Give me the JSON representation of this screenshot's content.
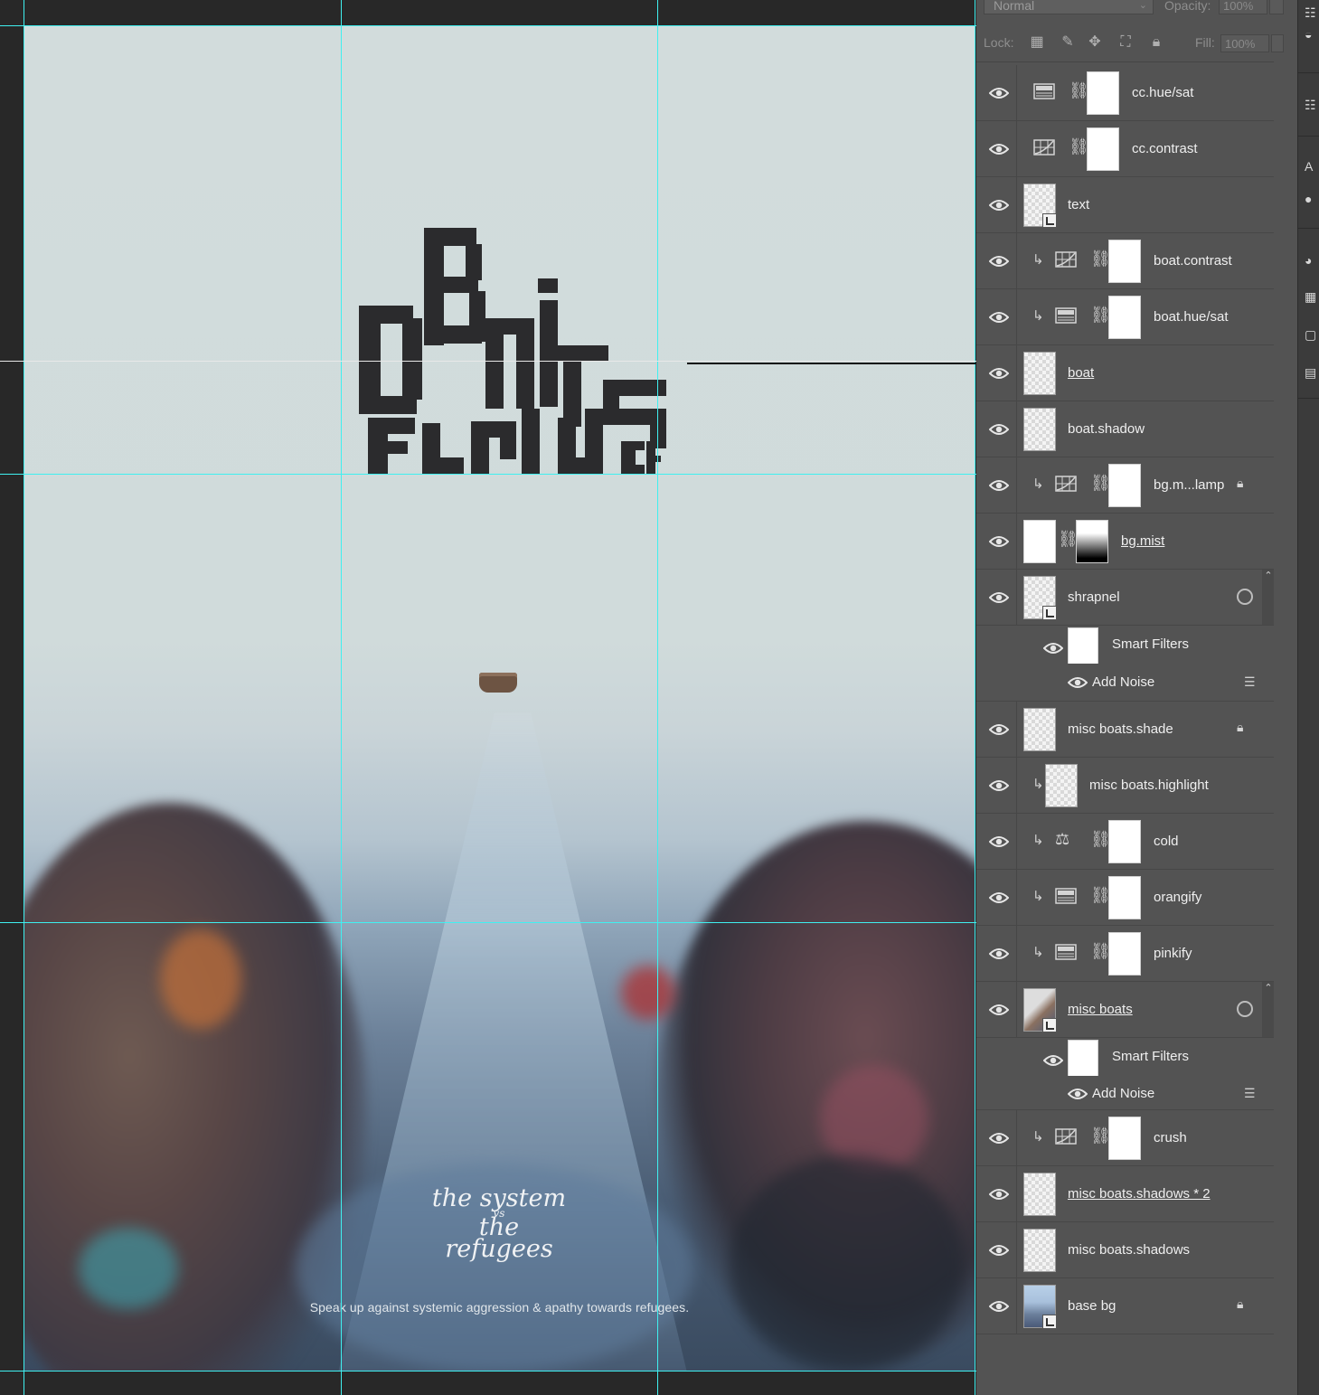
{
  "toolbar": {
    "blend_mode": "Normal",
    "opacity_label": "Opacity:",
    "opacity_value": "100%",
    "lock_label": "Lock:",
    "fill_label": "Fill:",
    "fill_value": "100%"
  },
  "artwork": {
    "script_line1": "the system",
    "script_vs": "vs",
    "script_line2": "the refugees",
    "tagline": "Speak up against systemic aggression & apathy towards refugees."
  },
  "layers": [
    {
      "name": "cc.hue/sat",
      "type": "adjustment",
      "icon": "hue-sat-icon",
      "clipped": false
    },
    {
      "name": "cc.contrast",
      "type": "adjustment",
      "icon": "curves-icon",
      "clipped": false
    },
    {
      "name": "text",
      "type": "smart-object",
      "clipped": false
    },
    {
      "name": "boat.contrast",
      "type": "adjustment",
      "icon": "curves-icon",
      "clipped": true
    },
    {
      "name": "boat.hue/sat",
      "type": "adjustment",
      "icon": "hue-sat-icon",
      "clipped": true
    },
    {
      "name": "boat",
      "type": "pixel",
      "clipped": false,
      "underlined": true
    },
    {
      "name": "boat.shadow",
      "type": "pixel",
      "clipped": false
    },
    {
      "name": "bg.m...lamp",
      "type": "adjustment",
      "icon": "curves-icon",
      "clipped": true,
      "locked": true
    },
    {
      "name": "bg.mist",
      "type": "masked",
      "clipped": false,
      "underlined": true
    },
    {
      "name": "shrapnel",
      "type": "smart-object",
      "clipped": false,
      "has_fx": true,
      "smart_filters": {
        "label": "Smart Filters",
        "filters": [
          "Add Noise"
        ]
      }
    },
    {
      "name": "misc boats.shade",
      "type": "pixel",
      "clipped": false,
      "locked": true
    },
    {
      "name": "misc boats.highlight",
      "type": "pixel",
      "clipped": true
    },
    {
      "name": "cold",
      "type": "adjustment",
      "icon": "color-balance-icon",
      "clipped": true
    },
    {
      "name": "orangify",
      "type": "adjustment",
      "icon": "hue-sat-icon",
      "clipped": true
    },
    {
      "name": "pinkify",
      "type": "adjustment",
      "icon": "hue-sat-icon",
      "clipped": true
    },
    {
      "name": "misc boats",
      "type": "smart-object",
      "clipped": false,
      "underlined": true,
      "has_fx": true,
      "smart_filters": {
        "label": "Smart Filters",
        "filters": [
          "Add Noise"
        ]
      }
    },
    {
      "name": "crush",
      "type": "adjustment",
      "icon": "curves-icon",
      "clipped": true
    },
    {
      "name": "misc boats.shadows * 2",
      "type": "pixel",
      "clipped": false,
      "underlined": true
    },
    {
      "name": "misc boats.shadows",
      "type": "pixel",
      "clipped": false
    },
    {
      "name": "base bg",
      "type": "smart-object",
      "clipped": false,
      "locked": true
    }
  ],
  "colors": {
    "guide": "#3ff0f0",
    "panel_bg": "#535353",
    "canvas_bg": "#282828",
    "title_ink": "#2b2b2d"
  }
}
